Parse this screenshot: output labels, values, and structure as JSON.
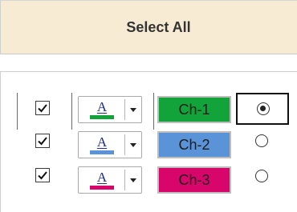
{
  "header": {
    "select_all_label": "Select All"
  },
  "channels": [
    {
      "label": "Ch-1",
      "checked": true,
      "color": "#12a33a",
      "selected": true
    },
    {
      "label": "Ch-2",
      "checked": true,
      "color": "#5b93d8",
      "selected": false
    },
    {
      "label": "Ch-3",
      "checked": true,
      "color": "#d8066a",
      "selected": false
    }
  ],
  "color_picker": {
    "glyph": "A"
  },
  "colors": {
    "header_bg": "#f7ebd3",
    "focus_line": "#1e7bd6"
  },
  "icons": {
    "checkbox": "checkmark-icon",
    "color_picker": "font-color-icon",
    "dropdown": "dropdown-arrow-icon",
    "radio": "radio-button-icon"
  }
}
